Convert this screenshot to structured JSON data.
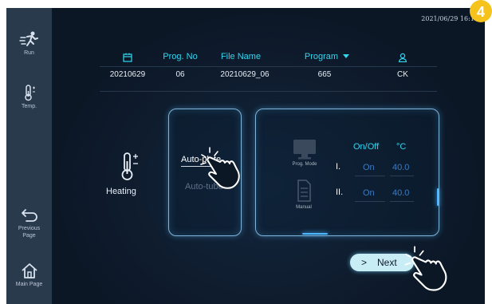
{
  "header": {
    "datetime": "2021/06/29 16:18"
  },
  "step_badge": "4",
  "sidebar": {
    "items": [
      {
        "label": "Run",
        "icon": "run-icon"
      },
      {
        "label": "Temp.",
        "icon": "thermometer-icon"
      },
      {
        "label": "Previous Page",
        "icon": "back-arrow-icon"
      },
      {
        "label": "Main Page",
        "icon": "home-icon"
      }
    ]
  },
  "table": {
    "date_icon": "calendar-icon",
    "headers": [
      "Prog. No",
      "File Name",
      "Program",
      ""
    ],
    "program_caret": "dropdown-caret-icon",
    "user_icon": "user-icon",
    "row": [
      "20210629",
      "06",
      "20210629_06",
      "665",
      "CK"
    ]
  },
  "heating": {
    "label": "Heating",
    "icon": "thermometer-plus-minus-icon"
  },
  "mode": {
    "selected": "Auto-plate",
    "other": "Auto-tube"
  },
  "control": {
    "prog_mode_label": "Prog. Mode",
    "manual_label": "Manual",
    "onoff_header": "On/Off",
    "unit_header": "°C",
    "rows": [
      {
        "roman": "I.",
        "state": "On",
        "temp": "40.0"
      },
      {
        "roman": "II.",
        "state": "On",
        "temp": "40.0"
      }
    ]
  },
  "next_button": {
    "label": "Next"
  },
  "colors": {
    "accent": "#33d6f0",
    "badge": "#f6c21c",
    "background": "#0d1827",
    "sidebar": "#2a3a4d"
  }
}
